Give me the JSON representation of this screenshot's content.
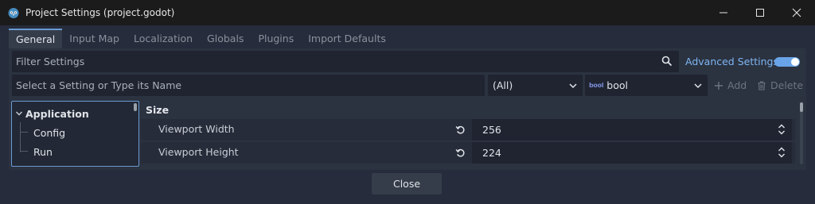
{
  "window": {
    "title": "Project Settings (project.godot)"
  },
  "tabs": [
    {
      "label": "General",
      "active": true
    },
    {
      "label": "Input Map",
      "active": false
    },
    {
      "label": "Localization",
      "active": false
    },
    {
      "label": "Globals",
      "active": false
    },
    {
      "label": "Plugins",
      "active": false
    },
    {
      "label": "Import Defaults",
      "active": false
    }
  ],
  "filter": {
    "placeholder": "Filter Settings",
    "advanced_label": "Advanced Settings",
    "advanced_enabled": true
  },
  "add_setting": {
    "placeholder": "Select a Setting or Type its Name",
    "feature_select": "(All)",
    "type_icon": "bool",
    "type_select": "bool",
    "add_label": "Add",
    "delete_label": "Delete"
  },
  "tree": {
    "category": "Application",
    "items": [
      "Config",
      "Run"
    ]
  },
  "inspector": {
    "section": "Size",
    "properties": [
      {
        "label": "Viewport Width",
        "value": "256"
      },
      {
        "label": "Viewport Height",
        "value": "224"
      }
    ]
  },
  "footer": {
    "close_label": "Close"
  },
  "colors": {
    "accent": "#6a9bd3",
    "link": "#7eb6f2",
    "panel": "#2b3240",
    "field": "#1f2430"
  }
}
